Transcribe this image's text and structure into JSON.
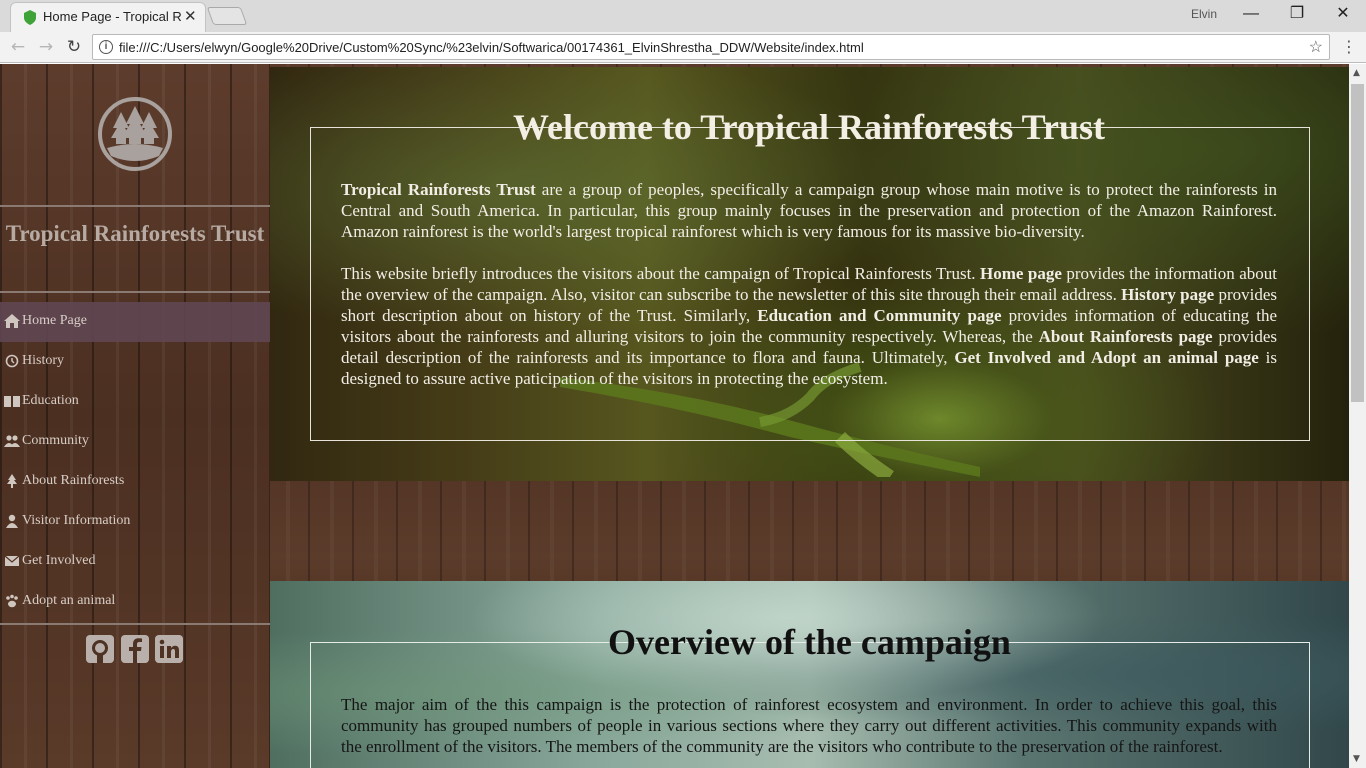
{
  "browser": {
    "tab_title": "Home Page - Tropical Rainforests Trust",
    "tab_close": "✕",
    "profile_name": "Elvin",
    "url": "file:///C:/Users/elwyn/Google%20Drive/Custom%20Sync/%23elvin/Softwarica/00174361_ElvinShrestha_DDW/Website/index.html",
    "window_controls": {
      "minimize": "—",
      "restore": "❐",
      "close": "✕"
    },
    "nav": {
      "back": "←",
      "forward": "→",
      "reload": "↻",
      "bookmark": "☆",
      "menu": "⋮"
    }
  },
  "sidebar": {
    "logo_icon": "pine-trees-logo",
    "site_name": "Tropical Rainforests Trust",
    "items": [
      {
        "label": "Home Page",
        "icon": "home-icon",
        "active": true
      },
      {
        "label": "History",
        "icon": "history-icon",
        "active": false
      },
      {
        "label": "Education",
        "icon": "book-icon",
        "active": false
      },
      {
        "label": "Community",
        "icon": "users-icon",
        "active": false
      },
      {
        "label": "About Rainforests",
        "icon": "tree-icon",
        "active": false
      },
      {
        "label": "Visitor Information",
        "icon": "user-icon",
        "active": false
      },
      {
        "label": "Get Involved",
        "icon": "envelope-icon",
        "active": false
      },
      {
        "label": "Adopt an animal",
        "icon": "paw-icon",
        "active": false
      }
    ],
    "social": [
      "github-icon",
      "facebook-icon",
      "linkedin-icon"
    ]
  },
  "welcome": {
    "title": "Welcome to Tropical Rainforests Trust",
    "p1_bold": "Tropical Rainforests Trust",
    "p1_text": " are a group of peoples, specifically a campaign group whose main motive is to protect the rainforests in Central and South America. In particular, this group mainly focuses in the preservation and protection of the Amazon Rainforest. Amazon rainforest is the world's largest tropical rainforest which is very famous for its massive bio-diversity.",
    "p2_a": "This website briefly introduces the visitors about the campaign of Tropical Rainforests Trust. ",
    "p2_b1": "Home page",
    "p2_c": " provides the information about the overview of the campaign. Also, visitor can subscribe to the newsletter of this site through their email address. ",
    "p2_b2": "History page",
    "p2_d": " provides short description about on history of the Trust. Similarly, ",
    "p2_b3": "Education and Community page",
    "p2_e": " provides information of educating the visitors about the rainforests and alluring visitors to join the community respectively. Whereas, the ",
    "p2_b4": "About Rainforests page",
    "p2_f": " provides detail description of the rainforests and its importance to flora and fauna. Ultimately, ",
    "p2_b5": "Get Involved and Adopt an animal page",
    "p2_g": " is designed to assure active paticipation of the visitors in protecting the ecosystem."
  },
  "overview": {
    "title": "Overview of the campaign",
    "p1": "The major aim of the this campaign is the protection of rainforest ecosystem and environment. In order to achieve this goal, this community has grouped numbers of people in various sections where they carry out different activities. This community expands with the enrollment of the visitors. The members of the community are the visitors who contribute to the preservation of the rainforest."
  }
}
